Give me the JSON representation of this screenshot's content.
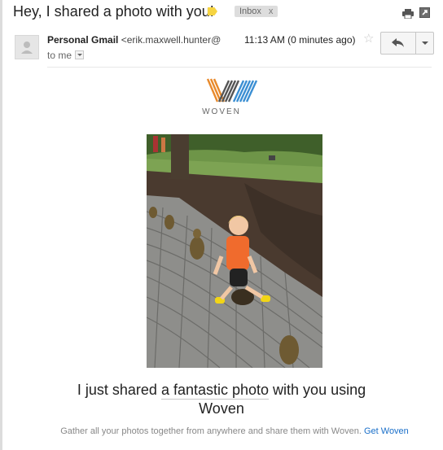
{
  "header": {
    "subject": "Hey, I shared a photo with you!",
    "label_name": "Inbox",
    "label_remove": "x",
    "label_color": "#f6d441"
  },
  "message": {
    "sender_name": "Personal Gmail",
    "sender_email": "<erik.maxwell.hunter@",
    "recipient_line": "to me",
    "timestamp": "11:13 AM (0 minutes ago)",
    "star_glyph": "☆"
  },
  "body": {
    "brand_name": "WOVEN",
    "logo_colors": [
      "#e88a2c",
      "#555555",
      "#3b8fd3"
    ],
    "headline_part1": "I just shared",
    "headline_link": "a fantastic photo",
    "headline_part2": "with you using",
    "headline_line2": "Woven",
    "footer_text": "Gather all your photos together from anywhere and share them with Woven.",
    "footer_link": "Get Woven",
    "link_color": "#1a6fc9"
  },
  "icons": {
    "print": "print-icon",
    "new_window": "new-window-icon",
    "reply": "reply-icon",
    "more": "chevron-down-icon",
    "avatar": "person-icon"
  }
}
